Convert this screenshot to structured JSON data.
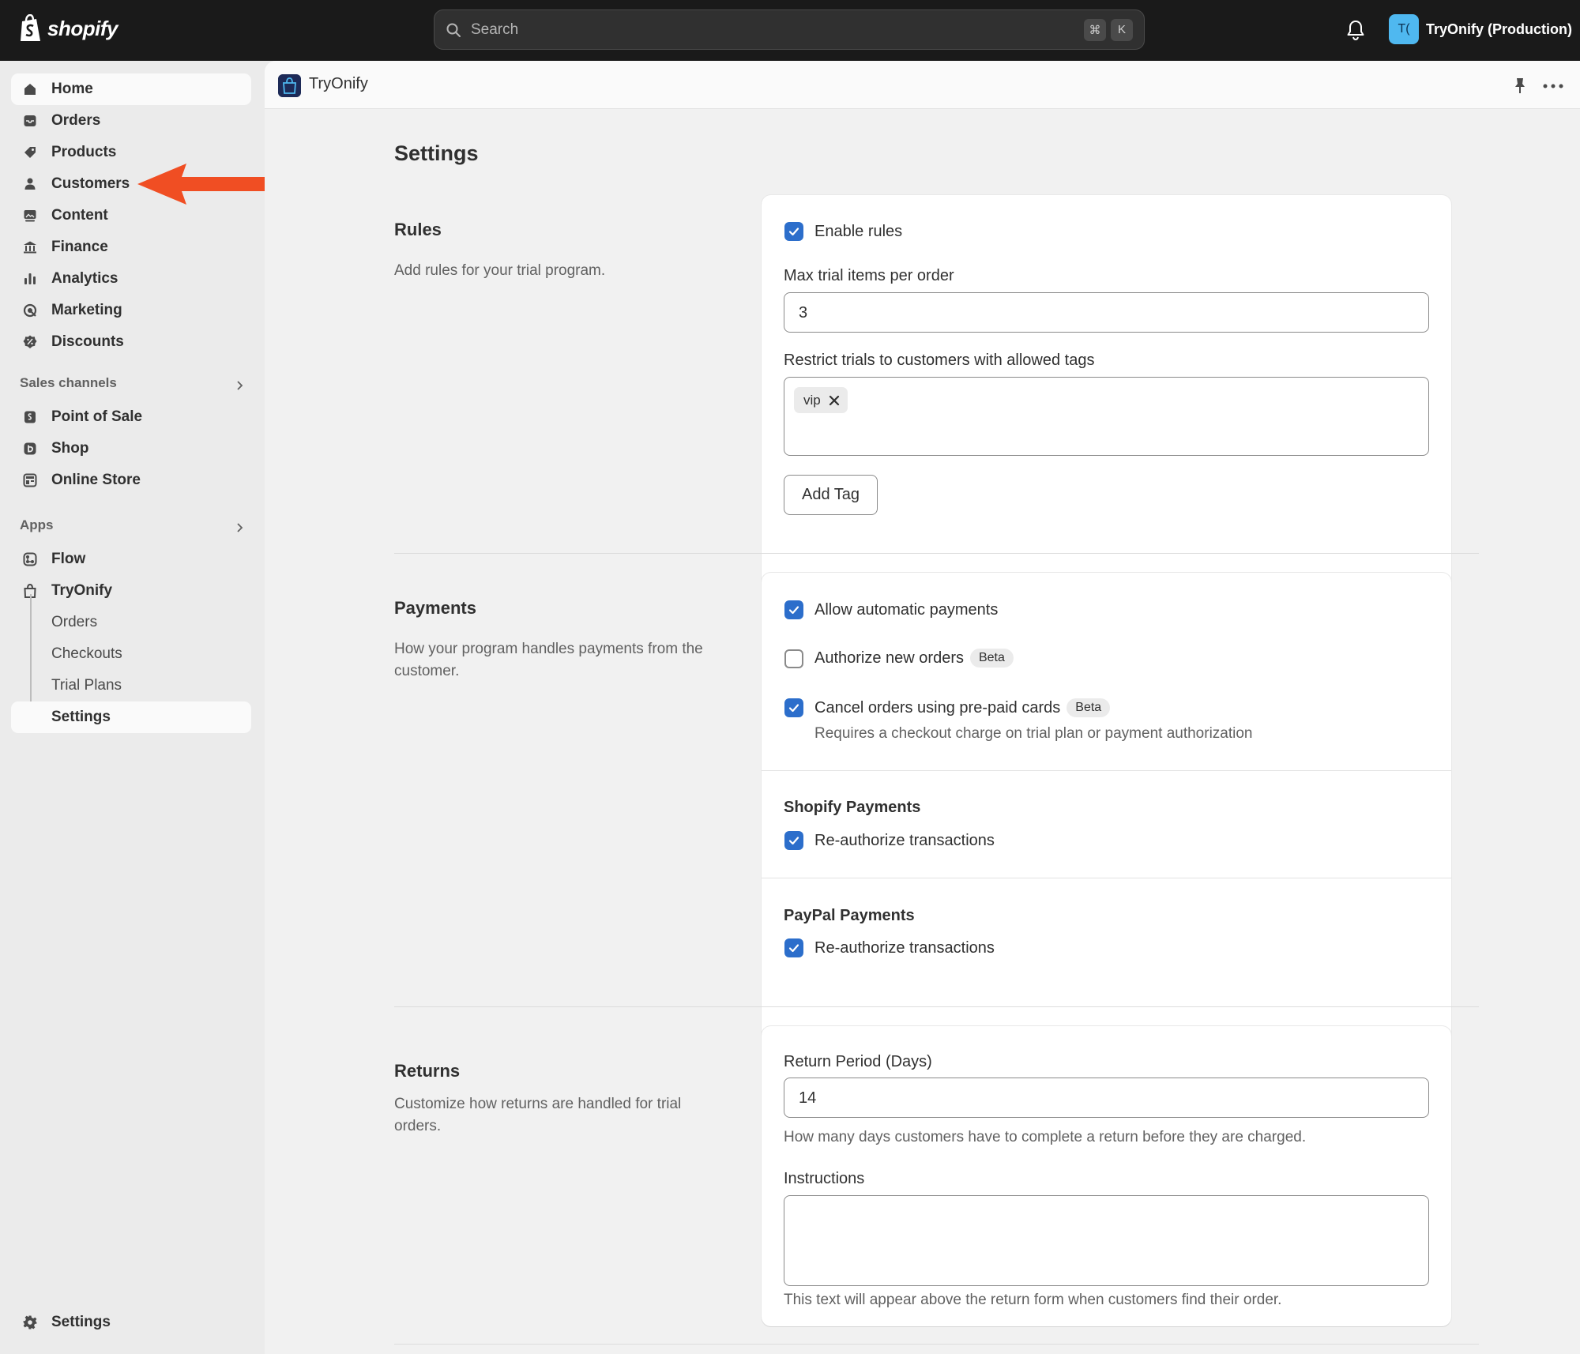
{
  "topbar": {
    "brand": "shopify",
    "search_placeholder": "Search",
    "shortcut_keys": [
      "⌘",
      "K"
    ],
    "avatar_initials": "T(",
    "store_name": "TryOnify (Production)"
  },
  "sidebar": {
    "main_items": [
      {
        "label": "Home",
        "icon": "home-icon"
      },
      {
        "label": "Orders",
        "icon": "inbox-icon"
      },
      {
        "label": "Products",
        "icon": "tag-icon"
      },
      {
        "label": "Customers",
        "icon": "person-icon"
      },
      {
        "label": "Content",
        "icon": "image-icon"
      },
      {
        "label": "Finance",
        "icon": "bank-icon"
      },
      {
        "label": "Analytics",
        "icon": "bar-chart-icon"
      },
      {
        "label": "Marketing",
        "icon": "target-icon"
      },
      {
        "label": "Discounts",
        "icon": "discount-icon"
      }
    ],
    "sales_channels_title": "Sales channels",
    "sales_channels": [
      {
        "label": "Point of Sale",
        "icon": "pos-icon"
      },
      {
        "label": "Shop",
        "icon": "shop-icon"
      },
      {
        "label": "Online Store",
        "icon": "store-icon"
      }
    ],
    "apps_title": "Apps",
    "apps": [
      {
        "label": "Flow",
        "icon": "flow-icon"
      },
      {
        "label": "TryOnify",
        "icon": "bag-icon"
      }
    ],
    "app_subitems": [
      "Orders",
      "Checkouts",
      "Trial Plans",
      "Settings"
    ],
    "footer_settings": "Settings"
  },
  "app_header": {
    "title": "TryOnify"
  },
  "page": {
    "title": "Settings"
  },
  "rules": {
    "title": "Rules",
    "description": "Add rules for your trial program.",
    "enable_rules_label": "Enable rules",
    "enable_rules_checked": true,
    "max_items_label": "Max trial items per order",
    "max_items_value": "3",
    "tags_label": "Restrict trials to customers with allowed tags",
    "tags": [
      "vip"
    ],
    "add_tag_button": "Add Tag"
  },
  "payments": {
    "title": "Payments",
    "description": "How your program handles payments from the customer.",
    "allow_auto_label": "Allow automatic payments",
    "allow_auto_checked": true,
    "authorize_label": "Authorize new orders",
    "authorize_checked": false,
    "authorize_badge": "Beta",
    "cancel_label": "Cancel orders using pre-paid cards",
    "cancel_checked": true,
    "cancel_badge": "Beta",
    "cancel_help": "Requires a checkout charge on trial plan or payment authorization",
    "shopify_payments_title": "Shopify Payments",
    "shopify_reauth_label": "Re-authorize transactions",
    "shopify_reauth_checked": true,
    "paypal_payments_title": "PayPal Payments",
    "paypal_reauth_label": "Re-authorize transactions",
    "paypal_reauth_checked": true
  },
  "returns": {
    "title": "Returns",
    "description": "Customize how returns are handled for trial orders.",
    "period_label": "Return Period (Days)",
    "period_value": "14",
    "period_help": "How many days customers have to complete a return before they are charged.",
    "instructions_label": "Instructions",
    "instructions_value": "",
    "instructions_help": "This text will appear above the return form when customers find their order."
  },
  "colors": {
    "accent_checkbox": "#2c6ecb",
    "annotation_arrow": "#f04e23",
    "topbar": "#1a1a1a",
    "avatar": "#4fb8f0"
  }
}
